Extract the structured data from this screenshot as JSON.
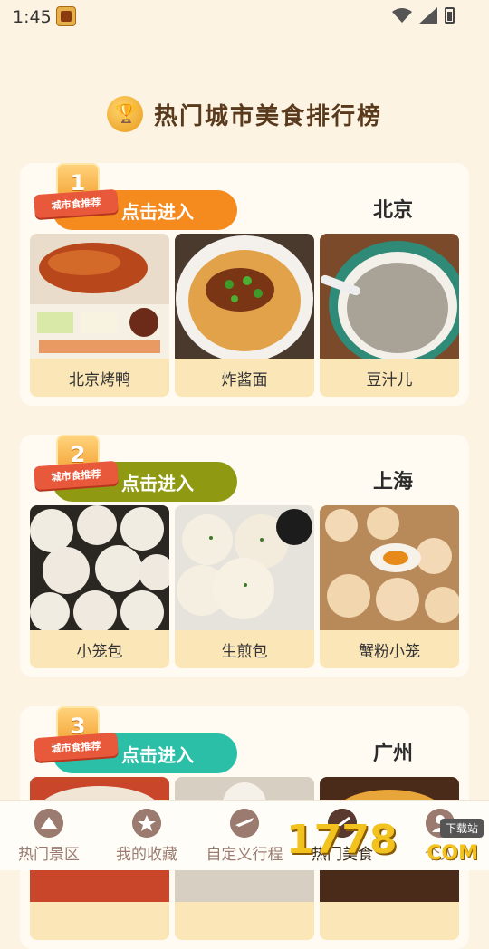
{
  "status_bar": {
    "time": "1:45"
  },
  "header": {
    "title": "热门城市美食排行榜"
  },
  "badge_text": "城市食推荐",
  "cards": [
    {
      "rank": "1",
      "enter_label": "点击进入",
      "city": "北京",
      "accent": "#f58a1f",
      "dishes": [
        {
          "name": "北京烤鸭"
        },
        {
          "name": "炸酱面"
        },
        {
          "name": "豆汁儿"
        }
      ]
    },
    {
      "rank": "2",
      "enter_label": "点击进入",
      "city": "上海",
      "accent": "#8f9a12",
      "dishes": [
        {
          "name": "小笼包"
        },
        {
          "name": "生煎包"
        },
        {
          "name": "蟹粉小笼"
        }
      ]
    },
    {
      "rank": "3",
      "enter_label": "点击进入",
      "city": "广州",
      "accent": "#2bbfa8",
      "dishes": []
    }
  ],
  "bottom_nav": [
    {
      "label": "热门景区",
      "icon": "landmark-icon"
    },
    {
      "label": "我的收藏",
      "icon": "star-icon"
    },
    {
      "label": "自定义行程",
      "icon": "plane-icon"
    },
    {
      "label": "热门美食",
      "icon": "food-icon",
      "active": true
    },
    {
      "label": "个人",
      "icon": "person-icon"
    }
  ],
  "watermark": {
    "number": "1778",
    "tag": "下载站",
    "domain": "COM"
  }
}
